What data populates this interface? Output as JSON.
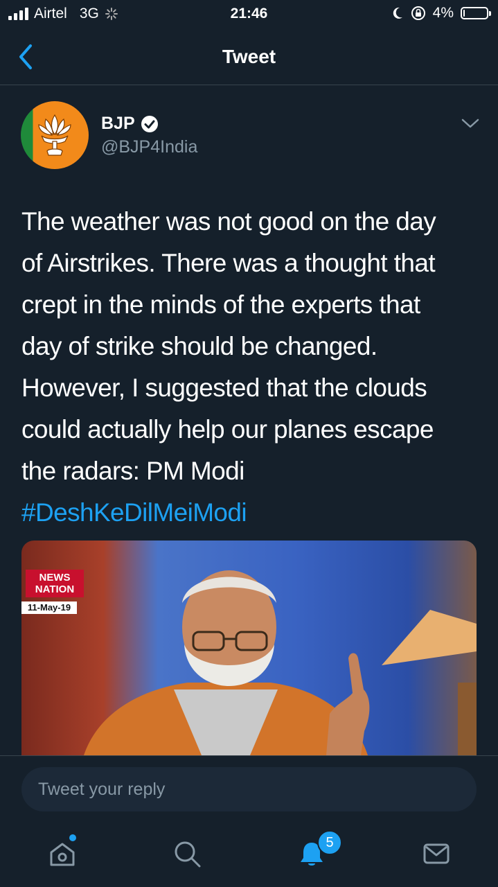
{
  "status_bar": {
    "carrier": "Airtel",
    "network": "3G",
    "time": "21:46",
    "battery": "4%",
    "battery_level": 0.04
  },
  "nav": {
    "title": "Tweet"
  },
  "tweet": {
    "user_name": "BJP",
    "handle": "@BJP4India",
    "text": "The weather was not good on the day\nof Airstrikes. There was a thought that\ncrept in the minds of the experts that\nday of strike should be changed.\nHowever, I suggested that the clouds\ncould actually help our planes escape\nthe radars: PM Modi",
    "hashtag": "#DeshKeDilMeiModi",
    "media": {
      "channel_logo": "NEWS NATION",
      "date": "11-May-19"
    }
  },
  "reply": {
    "placeholder": "Tweet your reply"
  },
  "tabbar": {
    "notifications_badge": "5"
  },
  "colors": {
    "background": "#15202b",
    "accent": "#1da1f2",
    "secondary_text": "#8899a6"
  }
}
